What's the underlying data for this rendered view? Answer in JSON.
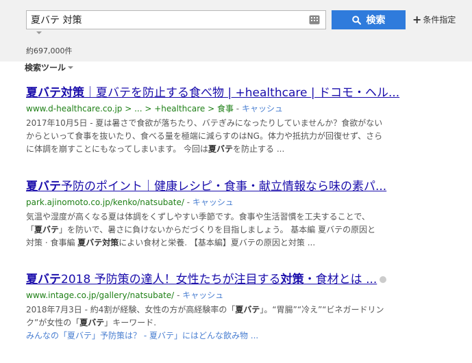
{
  "search": {
    "query": "夏バテ 対策",
    "button_label": "検索",
    "conditions_label": "条件指定",
    "result_count": "約697,000件",
    "tools_label": "検索ツール"
  },
  "results": [
    {
      "title_pre": "夏バテ対策",
      "title_rest": "｜夏バテを防止する食べ物 | +healthcare | ドコモ・ヘル...",
      "url": "www.d-healthcare.co.jp > ... > +healthcare > 食事",
      "cache_label": "キャッシュ",
      "snippet_1": "2017年10月5日 - 夏は暑さで食欲が落ちたり、バテぎみになったりしていませんか？食欲がない",
      "snippet_2": "からといって食事を抜いたり、食べる量を極端に減らすのはNG。体力や抵抗力が回復せず、さら",
      "snippet_3a": "に体調を崩すことにもなってしまいます。 今回は",
      "snippet_3b": "夏バテ",
      "snippet_3c": "を防止する ..."
    },
    {
      "title_pre": "夏バテ",
      "title_rest": "予防のポイント｜健康レシピ・食事・献立情報なら味の素パ...",
      "url": "park.ajinomoto.co.jp/kenko/natsubate/",
      "cache_label": "キャッシュ",
      "snippet_1": "気温や湿度が高くなる夏は体調をくずしやすい季節です。食事や生活習慣を工夫することで、",
      "snippet_2a": "「",
      "snippet_2b": "夏バテ",
      "snippet_2c": "」を防いで、暑さに負けないからだづくりを目指しましょう。 基本編 夏バテの原因と",
      "snippet_3a": "対策 · 食事編 ",
      "snippet_3b": "夏バテ対策",
      "snippet_3c": "によい食材と栄養. 【基本編】夏バテの原因と対策 ..."
    },
    {
      "title_pre": "夏バテ",
      "title_mid": "2018 予防策の達人！女性たちが注目する",
      "title_bold2": "対策",
      "title_rest": "・食材とは ...",
      "url": "www.intage.co.jp/gallery/natsubate/",
      "cache_label": "キャッシュ",
      "snippet_1a": "2018年7月3日 - 約4割が経験、女性の方が高経験率の「",
      "snippet_1b": "夏バテ",
      "snippet_1c": "」。“胃腸”“冷え”“ビネガードリン",
      "snippet_2a": "ク”が女性の「",
      "snippet_2b": "夏バテ",
      "snippet_2c": "」キーワード.",
      "sublink": "みんなの「夏バテ」予防策は？ - 夏バテ」にはどんな飲み物 ..."
    }
  ]
}
